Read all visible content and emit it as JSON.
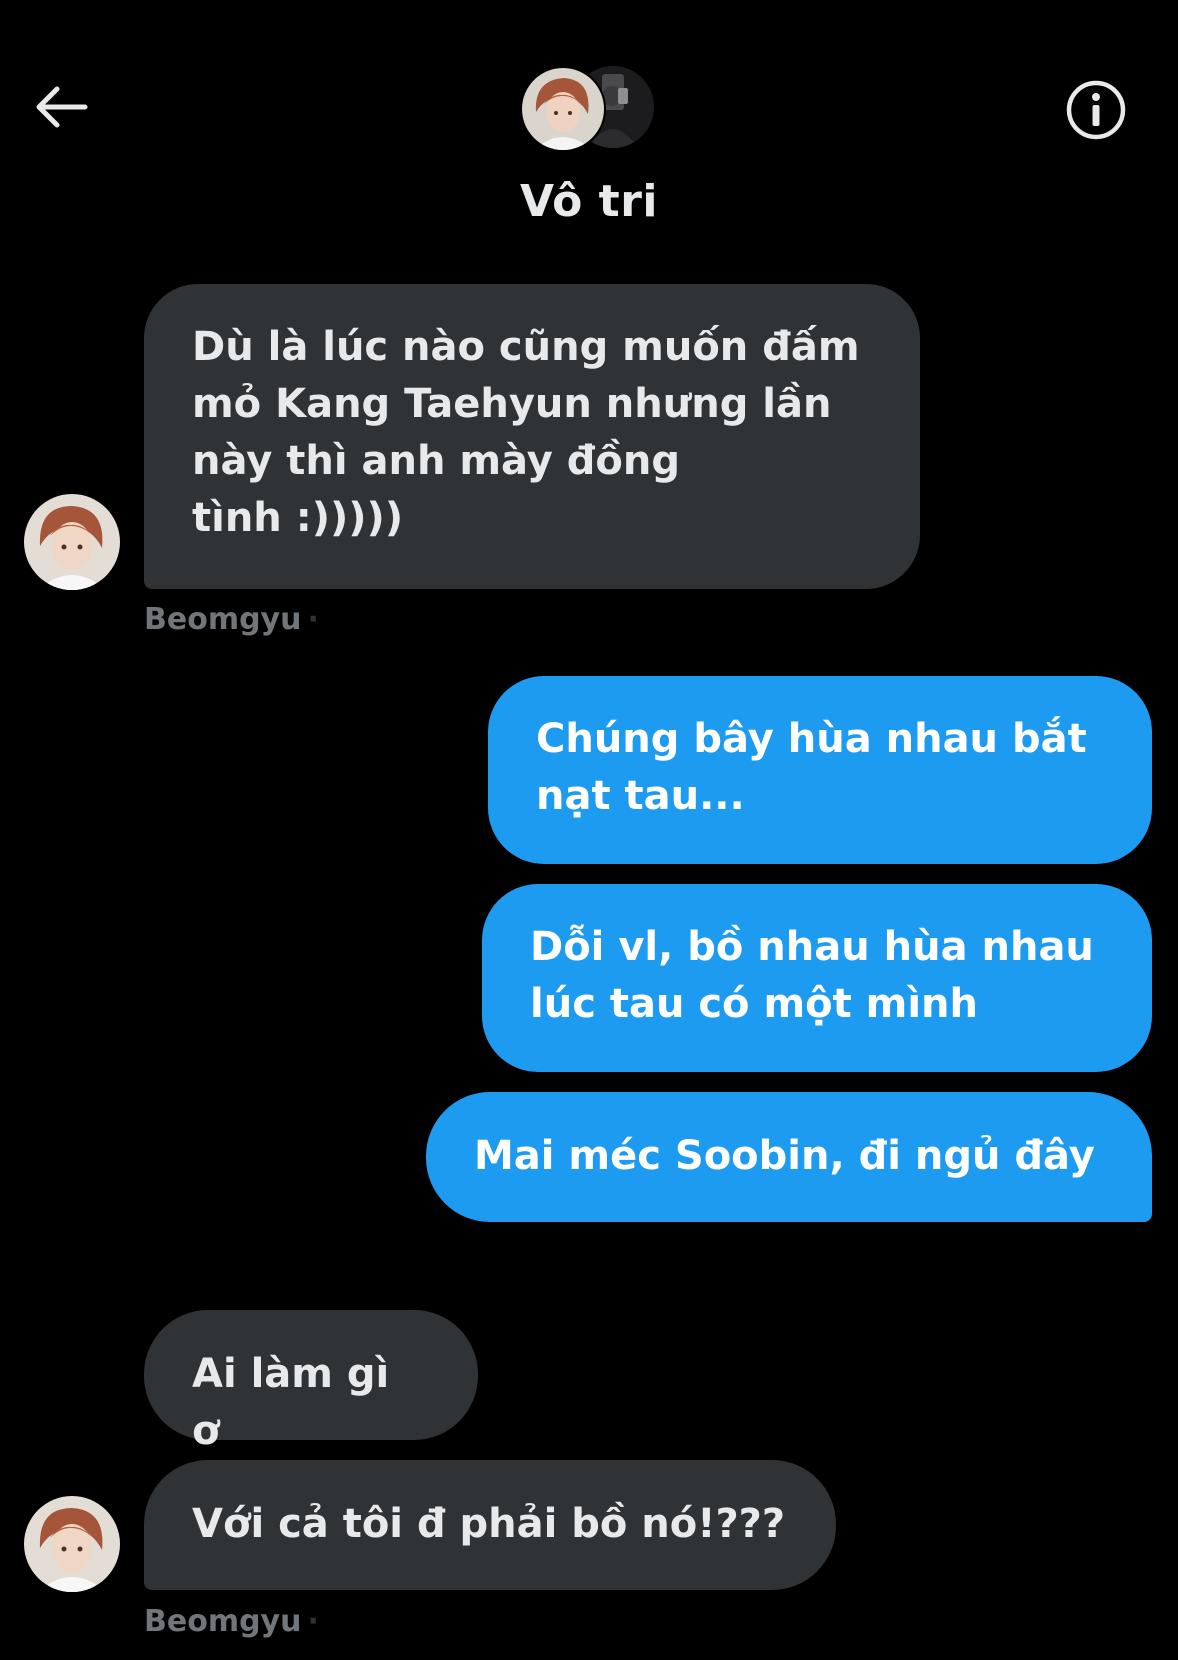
{
  "header": {
    "back_icon": "arrow-left-icon",
    "info_icon": "info-circle-icon",
    "title": "Vô tri",
    "avatars": [
      "group-member-avatar-1",
      "group-member-avatar-2"
    ]
  },
  "colors": {
    "background": "#000000",
    "incoming_bubble": "#2f3336",
    "outgoing_bubble": "#1d9bf0",
    "sender_name": "#71767b",
    "text": "#e7e9ea"
  },
  "messages": [
    {
      "direction": "incoming",
      "text": "Dù là lúc nào cũng muốn đấm\nmỏ Kang Taehyun nhưng lần\nnày thì anh mày đồng\ntình :)))))",
      "sender": "Beomgyu"
    },
    {
      "direction": "outgoing",
      "text": "Chúng bây hùa nhau bắt\nnạt tau..."
    },
    {
      "direction": "outgoing",
      "text": "Dỗi vl, bồ nhau hùa nhau\nlúc tau có một mình"
    },
    {
      "direction": "outgoing",
      "text": "Mai méc Soobin, đi ngủ đây"
    },
    {
      "direction": "incoming",
      "text": "Ai làm gì ơ"
    },
    {
      "direction": "incoming",
      "text": "Với cả tôi đ phải bồ nó!???",
      "sender": "Beomgyu"
    }
  ]
}
